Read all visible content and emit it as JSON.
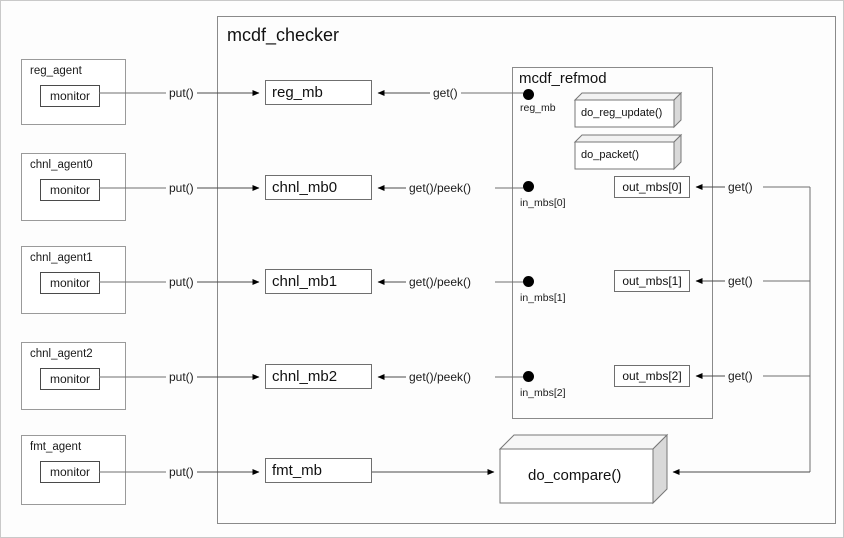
{
  "diagram": {
    "title": "mcdf_checker",
    "refmod_title": "mcdf_refmod"
  },
  "agents": [
    {
      "name": "reg_agent",
      "monitor": "monitor",
      "put": "put()"
    },
    {
      "name": "chnl_agent0",
      "monitor": "monitor",
      "put": "put()"
    },
    {
      "name": "chnl_agent1",
      "monitor": "monitor",
      "put": "put()"
    },
    {
      "name": "chnl_agent2",
      "monitor": "monitor",
      "put": "put()"
    },
    {
      "name": "fmt_agent",
      "monitor": "monitor",
      "put": "put()"
    }
  ],
  "mailboxes": [
    {
      "label": "reg_mb",
      "edge": "get()"
    },
    {
      "label": "chnl_mb0",
      "edge": "get()/peek()"
    },
    {
      "label": "chnl_mb1",
      "edge": "get()/peek()"
    },
    {
      "label": "chnl_mb2",
      "edge": "get()/peek()"
    },
    {
      "label": "fmt_mb",
      "edge": ""
    }
  ],
  "ports": [
    {
      "label": "reg_mb"
    },
    {
      "label": "in_mbs[0]"
    },
    {
      "label": "in_mbs[1]"
    },
    {
      "label": "in_mbs[2]"
    }
  ],
  "methods": [
    {
      "label": "do_reg_update()"
    },
    {
      "label": "do_packet()"
    }
  ],
  "out_mailboxes": [
    {
      "label": "out_mbs[0]",
      "edge": "get()"
    },
    {
      "label": "out_mbs[1]",
      "edge": "get()"
    },
    {
      "label": "out_mbs[2]",
      "edge": "get()"
    }
  ],
  "compare": {
    "label": "do_compare()"
  },
  "colors": {
    "line": "#6f6f6f",
    "arrow": "#000000",
    "cube_side": "#d9d9d9",
    "cube_top": "#f2f2f2",
    "box_border": "#7d7d7d",
    "text": "#111111"
  }
}
